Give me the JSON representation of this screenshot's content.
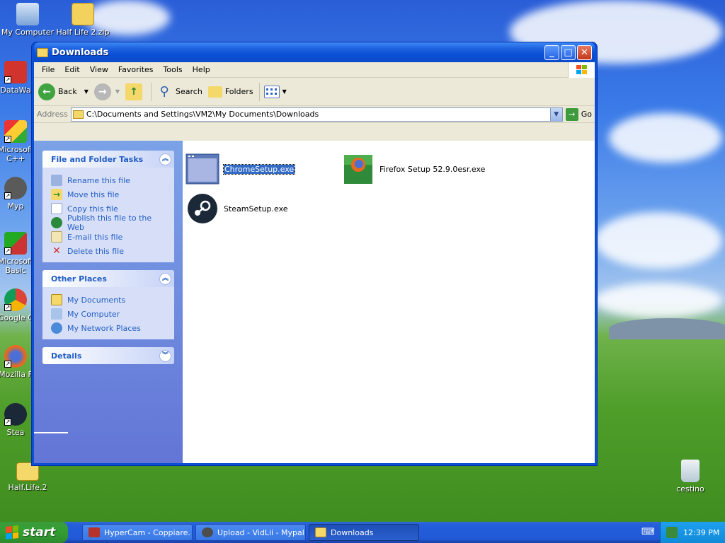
{
  "desktop": {
    "icons": [
      {
        "label": "My Computer"
      },
      {
        "label": "Half Life 2.zip"
      },
      {
        "label": "DataWa"
      },
      {
        "label": "Microsoft C++"
      },
      {
        "label": "Myp"
      },
      {
        "label": "Microsoft Basic"
      },
      {
        "label": "Google C"
      },
      {
        "label": "Mozilla F"
      },
      {
        "label": "Stea"
      },
      {
        "label": "Half.Life.2"
      },
      {
        "label": "cestino"
      }
    ]
  },
  "window": {
    "title": "Downloads",
    "buttons": {
      "minimize": "_",
      "maximize": "□",
      "close": "✕"
    }
  },
  "menubar": [
    "File",
    "Edit",
    "View",
    "Favorites",
    "Tools",
    "Help"
  ],
  "toolbar": {
    "back": "Back",
    "search": "Search",
    "folders": "Folders"
  },
  "address": {
    "label": "Address",
    "value": "C:\\Documents and Settings\\VM2\\My Documents\\Downloads",
    "go": "Go"
  },
  "taskpane": {
    "file_tasks": {
      "title": "File and Folder Tasks",
      "items": [
        "Rename this file",
        "Move this file",
        "Copy this file",
        "Publish this file to the Web",
        "E-mail this file",
        "Delete this file"
      ]
    },
    "other_places": {
      "title": "Other Places",
      "items": [
        "My Documents",
        "My Computer",
        "My Network Places"
      ]
    },
    "details": {
      "title": "Details"
    }
  },
  "files": [
    {
      "name": "ChromeSetup.exe",
      "selected": true
    },
    {
      "name": "Firefox Setup 52.9.0esr.exe",
      "selected": false
    },
    {
      "name": "SteamSetup.exe",
      "selected": false
    }
  ],
  "taskbar": {
    "start": "start",
    "tasks": [
      "HyperCam - Coppiare.",
      "Upload - VidLii - Mypal",
      "Downloads"
    ],
    "clock": "12:39 PM"
  }
}
